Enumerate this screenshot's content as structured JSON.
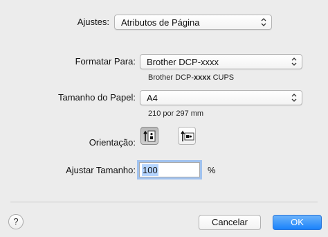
{
  "settings": {
    "label": "Ajustes:",
    "value": "Atributos de Página"
  },
  "format_for": {
    "label": "Formatar Para:",
    "value": "Brother DCP-xxxx",
    "subtitle_prefix": "Brother DCP-",
    "subtitle_model": "xxxx",
    "subtitle_suffix": " CUPS"
  },
  "paper_size": {
    "label": "Tamanho do Papel:",
    "value": "A4",
    "dimensions": "210 por 297 mm"
  },
  "orientation": {
    "label": "Orientação:",
    "selected": "portrait"
  },
  "scale": {
    "label": "Ajustar Tamanho:",
    "value": "100",
    "unit": "%"
  },
  "buttons": {
    "help": "?",
    "cancel": "Cancelar",
    "ok": "OK"
  },
  "colors": {
    "accent": "#1a82fb",
    "selection": "#b5d5ff",
    "background": "#ececec"
  }
}
